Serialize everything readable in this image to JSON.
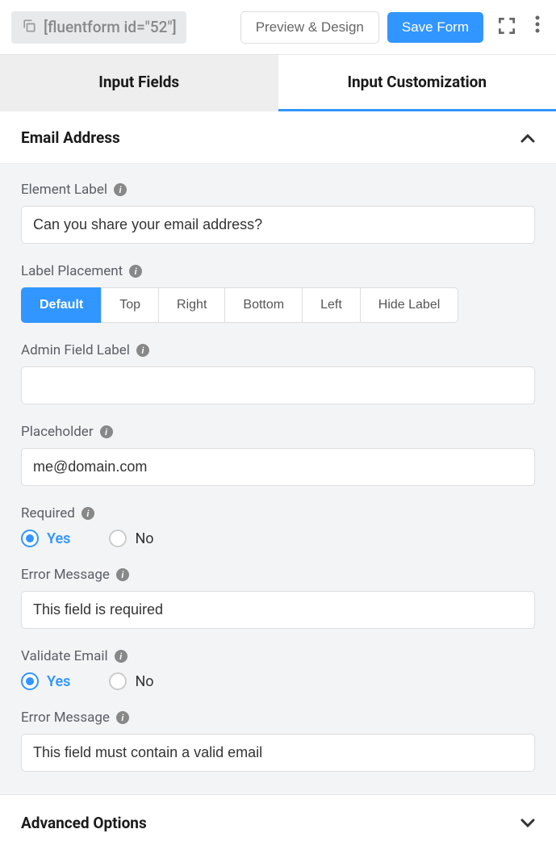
{
  "header": {
    "shortcode": "[fluentform id=\"52\"]",
    "preview_button": "Preview & Design",
    "save_button": "Save Form"
  },
  "tabs": {
    "input_fields": "Input Fields",
    "input_customization": "Input Customization"
  },
  "section": {
    "title": "Email Address"
  },
  "fields": {
    "element_label": {
      "label": "Element Label",
      "value": "Can you share your email address?"
    },
    "label_placement": {
      "label": "Label Placement",
      "options": [
        "Default",
        "Top",
        "Right",
        "Bottom",
        "Left",
        "Hide Label"
      ],
      "selected": "Default"
    },
    "admin_field_label": {
      "label": "Admin Field Label",
      "value": ""
    },
    "placeholder": {
      "label": "Placeholder",
      "value": "me@domain.com"
    },
    "required": {
      "label": "Required",
      "yes": "Yes",
      "no": "No",
      "selected": "Yes"
    },
    "error_message_required": {
      "label": "Error Message",
      "value": "This field is required"
    },
    "validate_email": {
      "label": "Validate Email",
      "yes": "Yes",
      "no": "No",
      "selected": "Yes"
    },
    "error_message_email": {
      "label": "Error Message",
      "value": "This field must contain a valid email"
    }
  },
  "advanced": {
    "title": "Advanced Options"
  }
}
